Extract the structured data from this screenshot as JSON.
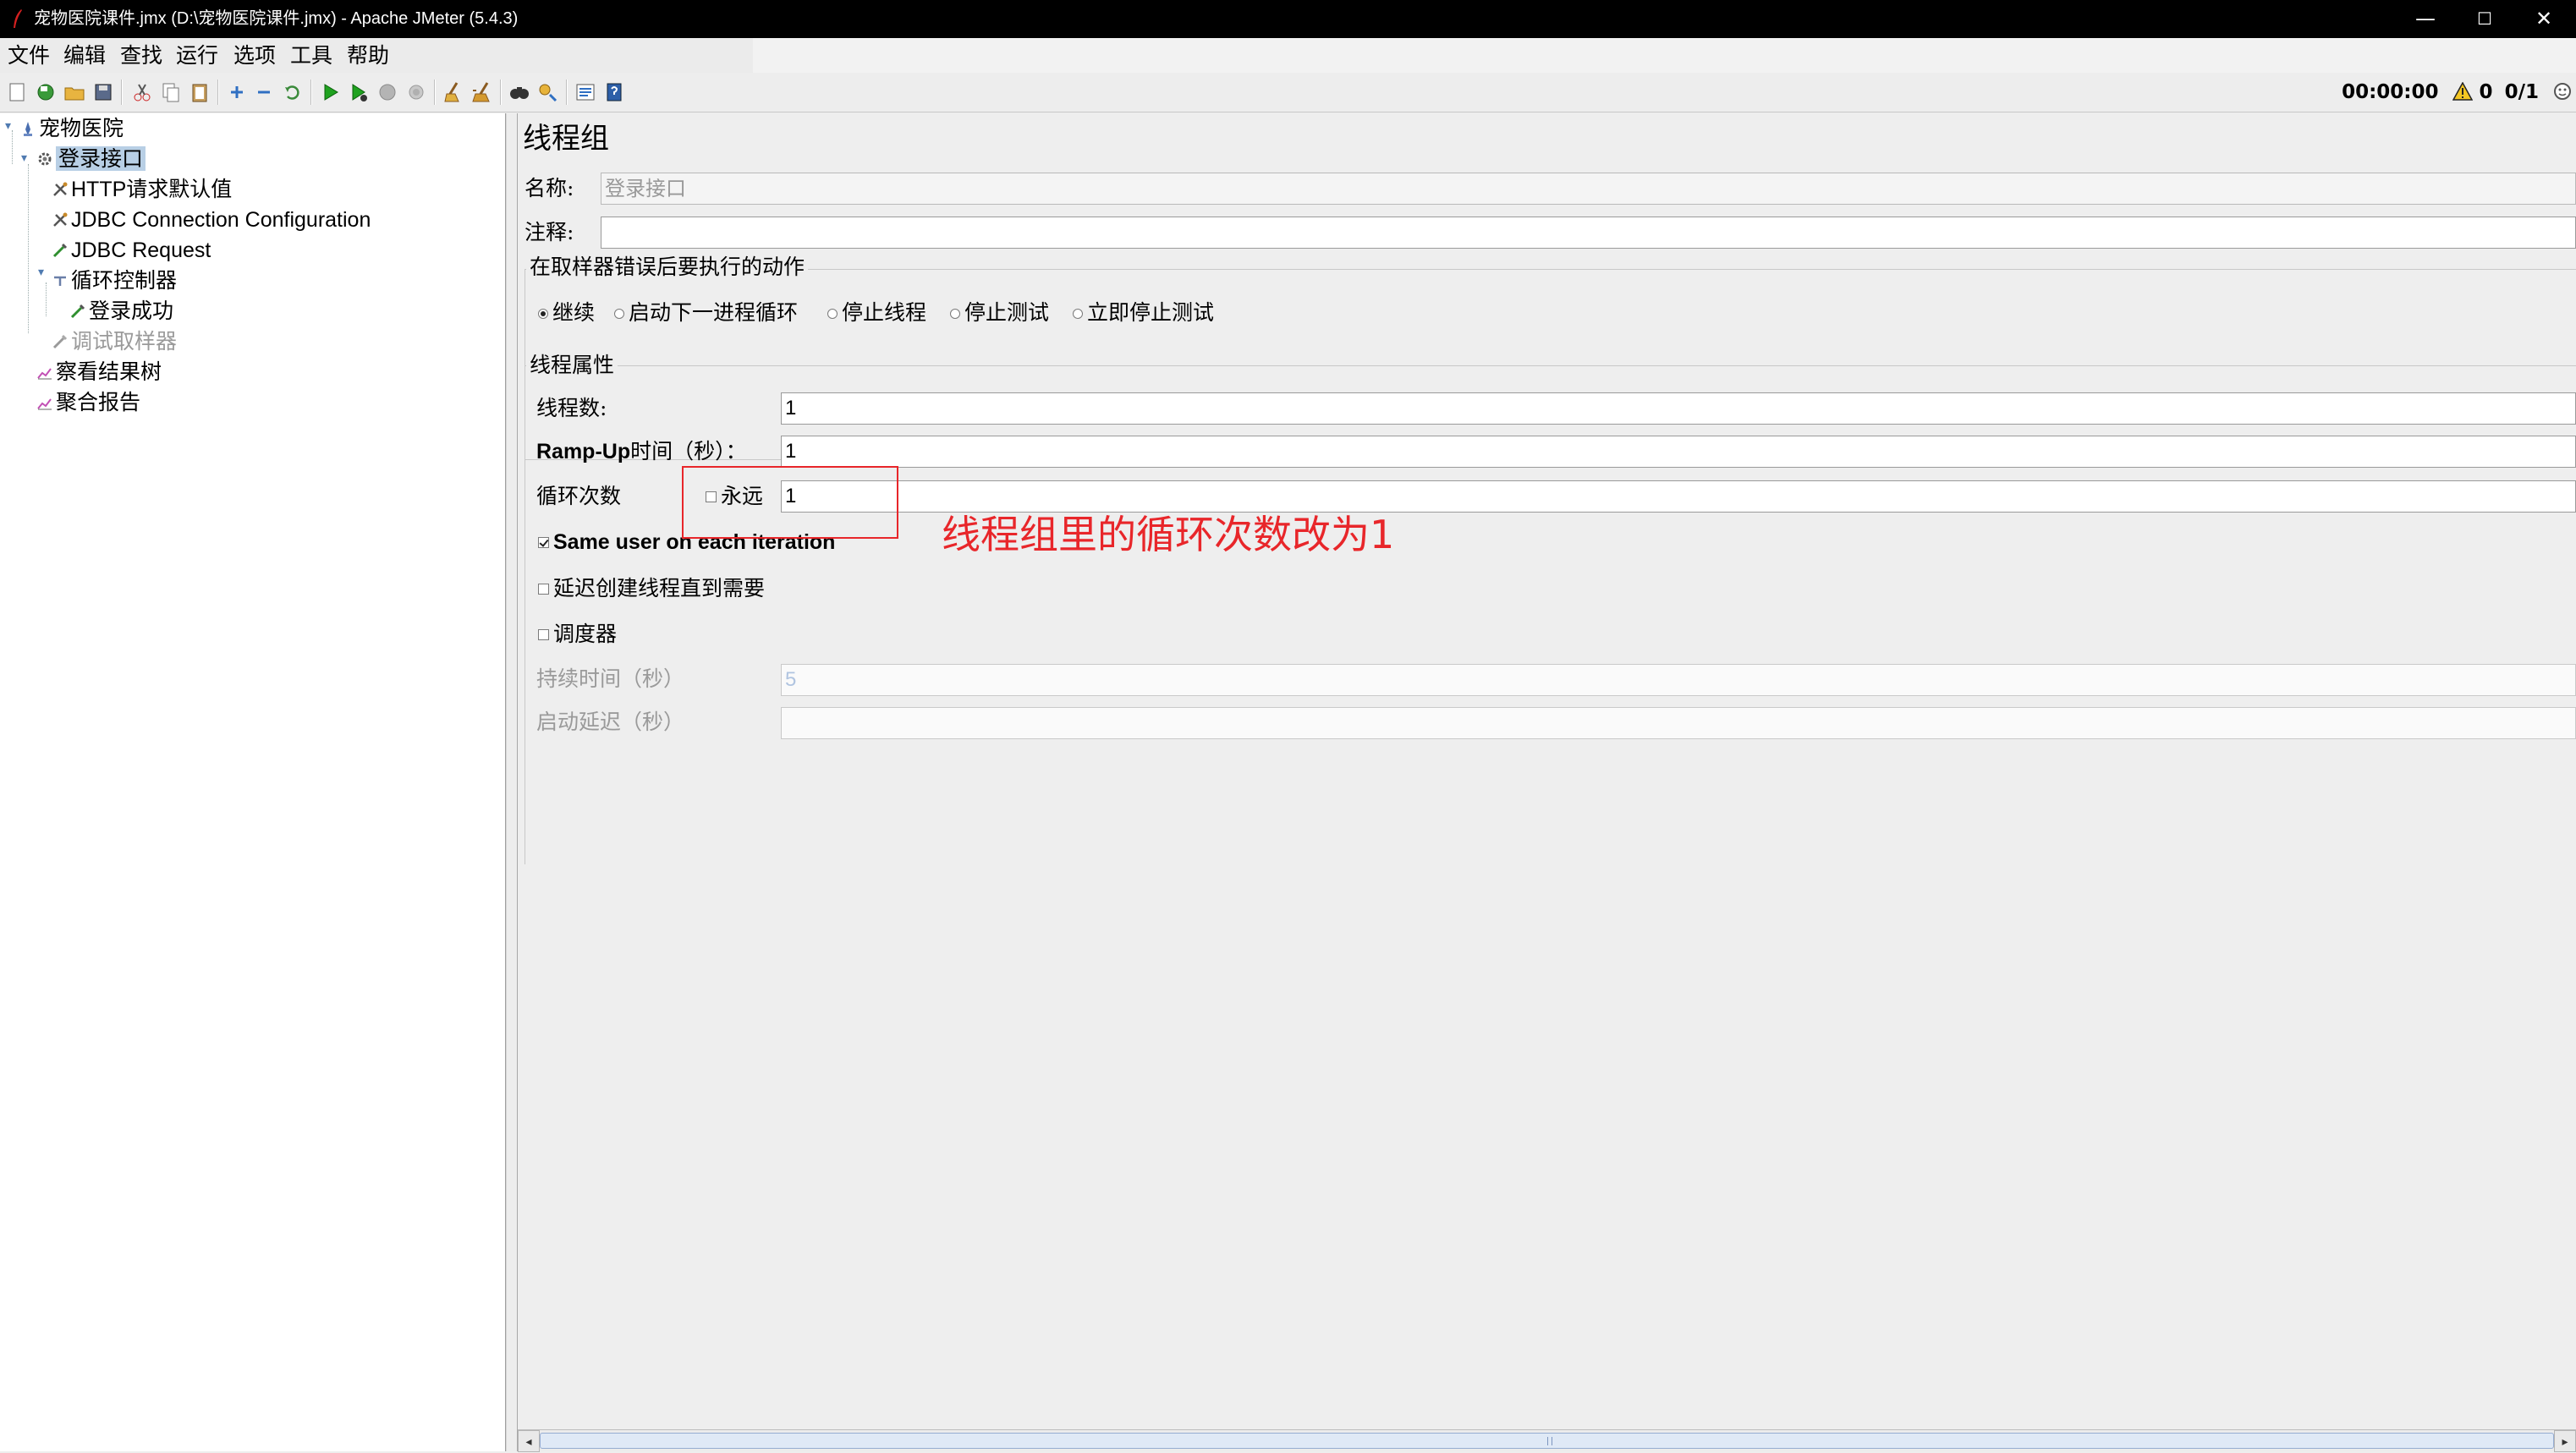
{
  "window": {
    "title": "宠物医院课件.jmx (D:\\宠物医院课件.jmx) - Apache JMeter (5.4.3)",
    "controls": {
      "minimize": "—",
      "maximize": "☐",
      "close": "✕"
    }
  },
  "menu": [
    "文件",
    "编辑",
    "查找",
    "运行",
    "选项",
    "工具",
    "帮助"
  ],
  "toolbar_icons": [
    "new-icon",
    "templates-icon",
    "open-icon",
    "save-icon",
    "cut-icon",
    "copy-icon",
    "paste-icon",
    "expand-icon",
    "collapse-icon",
    "toggle-icon",
    "start-icon",
    "start-no-pause-icon",
    "stop-icon",
    "shutdown-icon",
    "clear-icon",
    "clear-all-icon",
    "search-icon",
    "reset-search-icon",
    "function-helper-icon",
    "help-icon"
  ],
  "status": {
    "timer": "00:00:00",
    "warnings": "0",
    "threads": "0/1"
  },
  "tree": {
    "root": "宠物医院",
    "thread_group": "登录接口",
    "http_defaults": "HTTP请求默认值",
    "jdbc_config": "JDBC Connection Configuration",
    "jdbc_request": "JDBC Request",
    "loop_controller": "循环控制器",
    "login_success": "登录成功",
    "debug_sampler": "调试取样器",
    "results_tree": "察看结果树",
    "aggregate_report": "聚合报告"
  },
  "panel": {
    "title": "线程组",
    "name_label": "名称:",
    "name_value": "登录接口",
    "comment_label": "注释:",
    "comment_value": "",
    "error_action_title": "在取样器错误后要执行的动作",
    "error_actions": [
      "继续",
      "启动下一进程循环",
      "停止线程",
      "停止测试",
      "立即停止测试"
    ],
    "error_action_selected": "继续",
    "thread_props_title": "线程属性",
    "threads_label": "线程数:",
    "threads_value": "1",
    "rampup_label_en": "Ramp-Up",
    "rampup_label_cn": "时间（秒）：",
    "rampup_value": "1",
    "loop_label": "循环次数",
    "forever_label": "永远",
    "loop_value": "1",
    "same_user_label": "Same user on each iteration",
    "delay_label": "延迟创建线程直到需要",
    "scheduler_label": "调度器",
    "duration_label": "持续时间（秒）",
    "duration_value": "5",
    "startup_delay_label": "启动延迟（秒）",
    "startup_delay_value": ""
  },
  "annotation": {
    "text": "线程组里的循环次数改为1",
    "color": "#e8262a"
  }
}
